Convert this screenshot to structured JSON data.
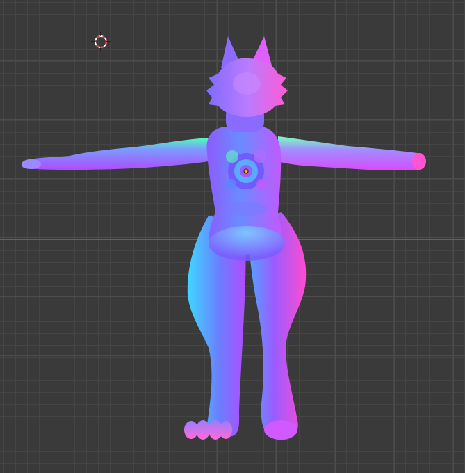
{
  "viewport": {
    "background": "#3a3a3a",
    "grid_line_color": "#464646",
    "x_axis_color": "#9b4a4a",
    "y_axis_color": "#5b78b0",
    "model_shading": "normal-map",
    "model_colors": {
      "pink": "#ff4bd8",
      "violet": "#8a4bff",
      "blue": "#5a7dff",
      "cyan": "#3fe3ff",
      "green": "#48ffb0"
    }
  },
  "cursor": {
    "icon": "3d-cursor-icon",
    "ring_color": "#ffffff",
    "dash_color": "#e04040"
  },
  "origin": {
    "icon": "object-origin-icon",
    "color": "#ffb100"
  }
}
